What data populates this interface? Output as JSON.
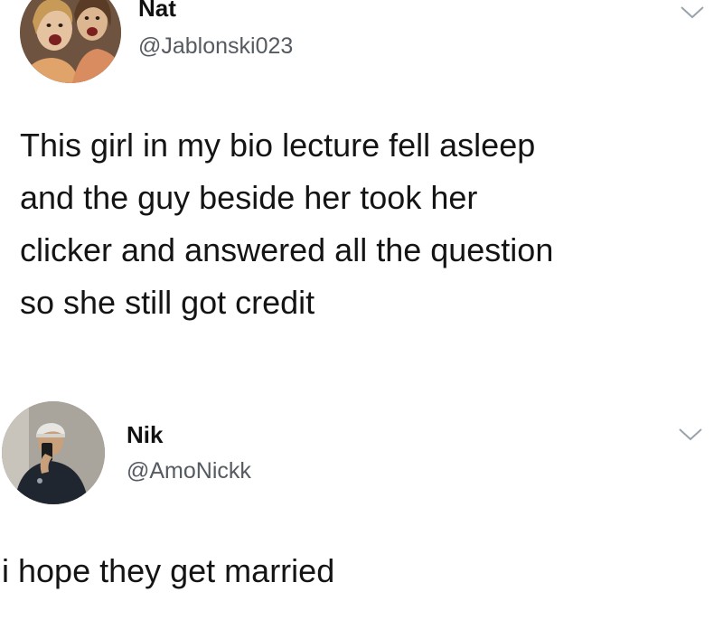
{
  "tweets": [
    {
      "display_name": "Nat",
      "handle": "@Jablonski023",
      "text": "This girl in my bio lecture fell asleep\nand the guy beside her took her\nclicker and answered all the question\nso she still got credit",
      "avatar_icon": "profile-photo-two-girls",
      "menu_icon": "chevron-down-icon"
    },
    {
      "display_name": "Nik",
      "handle": "@AmoNickk",
      "text": "i hope they get married",
      "avatar_icon": "profile-photo-mirror-selfie",
      "menu_icon": "chevron-down-icon"
    }
  ],
  "colors": {
    "text": "#141414",
    "handle": "#555b61",
    "chevron": "#9aa3ab",
    "background": "#ffffff"
  }
}
